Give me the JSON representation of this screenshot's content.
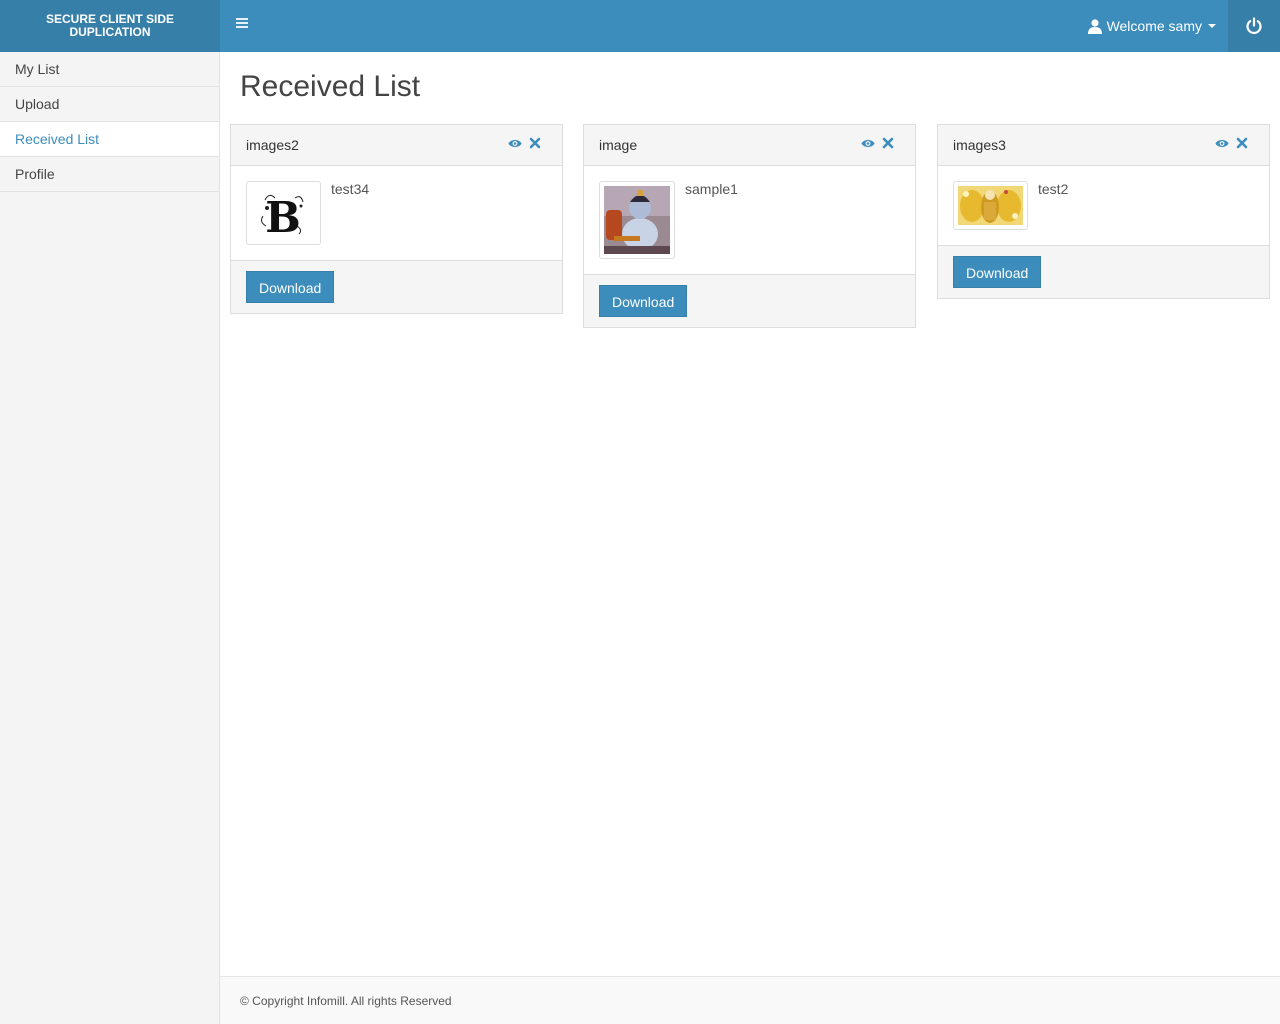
{
  "brand": {
    "title": "SECURE CLIENT SIDE DUPLICATION"
  },
  "header": {
    "menu_toggle_icon": "hamburger-icon",
    "user_label": "Welcome samy",
    "user_icon": "user-icon",
    "power_icon": "power-icon",
    "accent_color": "#3c8dbc"
  },
  "sidebar": {
    "items": [
      {
        "label": "My List",
        "active": false
      },
      {
        "label": "Upload",
        "active": false
      },
      {
        "label": "Received List",
        "active": true
      },
      {
        "label": "Profile",
        "active": false
      }
    ]
  },
  "main": {
    "title": "Received List",
    "cards": [
      {
        "title": "images2",
        "file": "test34",
        "thumb": "letter-b-thumbnail",
        "button": "Download"
      },
      {
        "title": "image",
        "file": "sample1",
        "thumb": "child-figure-thumbnail",
        "button": "Download"
      },
      {
        "title": "images3",
        "file": "test2",
        "thumb": "golden-figure-thumbnail",
        "button": "Download"
      }
    ]
  },
  "footer": {
    "text": "© Copyright Infomill. All rights Reserved"
  }
}
